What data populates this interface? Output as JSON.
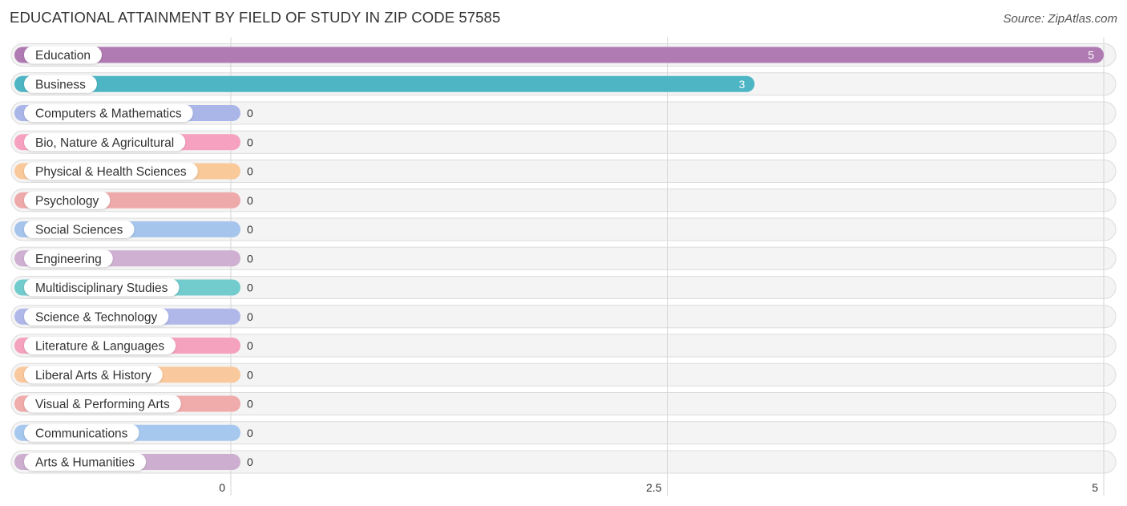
{
  "header": {
    "title": "EDUCATIONAL ATTAINMENT BY FIELD OF STUDY IN ZIP CODE 57585",
    "source": "Source: ZipAtlas.com"
  },
  "chart_data": {
    "type": "bar",
    "orientation": "horizontal",
    "title": "EDUCATIONAL ATTAINMENT BY FIELD OF STUDY IN ZIP CODE 57585",
    "xlabel": "",
    "ylabel": "",
    "xlim": [
      0,
      5
    ],
    "x_ticks": [
      0,
      2.5,
      5
    ],
    "x_tick_labels": [
      "0",
      "2.5",
      "5"
    ],
    "grid": true,
    "categories": [
      "Education",
      "Business",
      "Computers & Mathematics",
      "Bio, Nature & Agricultural",
      "Physical & Health Sciences",
      "Psychology",
      "Social Sciences",
      "Engineering",
      "Multidisciplinary Studies",
      "Science & Technology",
      "Literature & Languages",
      "Liberal Arts & History",
      "Visual & Performing Arts",
      "Communications",
      "Arts & Humanities"
    ],
    "values": [
      5,
      3,
      0,
      0,
      0,
      0,
      0,
      0,
      0,
      0,
      0,
      0,
      0,
      0,
      0
    ],
    "value_labels": [
      "5",
      "3",
      "0",
      "0",
      "0",
      "0",
      "0",
      "0",
      "0",
      "0",
      "0",
      "0",
      "0",
      "0",
      "0"
    ],
    "colors": [
      "#b07ab3",
      "#4db5c4",
      "#aab6e8",
      "#f6a1bf",
      "#f9c99a",
      "#eeaaaa",
      "#a6c5ec",
      "#cfb0d2",
      "#72cbcd",
      "#b0b8ea",
      "#f5a2bf",
      "#f9c99d",
      "#f0abab",
      "#a6c8ee",
      "#cdaed0"
    ]
  }
}
